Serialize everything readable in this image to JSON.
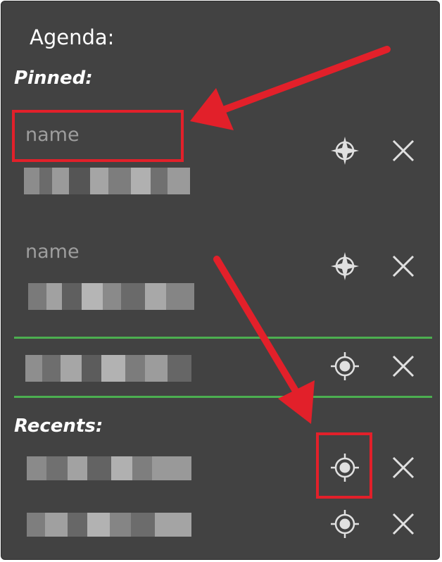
{
  "header": {
    "title": "Agenda:"
  },
  "pinned": {
    "label": "Pinned:",
    "items": [
      {
        "name_placeholder": "name",
        "detail": "",
        "icon": "navigation-crosshair-icon"
      },
      {
        "name_placeholder": "name",
        "detail": "",
        "icon": "navigation-crosshair-icon"
      },
      {
        "name_placeholder": "",
        "detail": "",
        "icon": "location-target-icon"
      }
    ]
  },
  "recents": {
    "label": "Recents:",
    "items": [
      {
        "detail": "",
        "icon": "location-target-icon"
      },
      {
        "detail": "",
        "icon": "location-target-icon"
      }
    ]
  },
  "colors": {
    "panel_bg": "#424242",
    "divider": "#4caf50",
    "annotation": "#e2202a",
    "icon": "#e0e0e0"
  }
}
